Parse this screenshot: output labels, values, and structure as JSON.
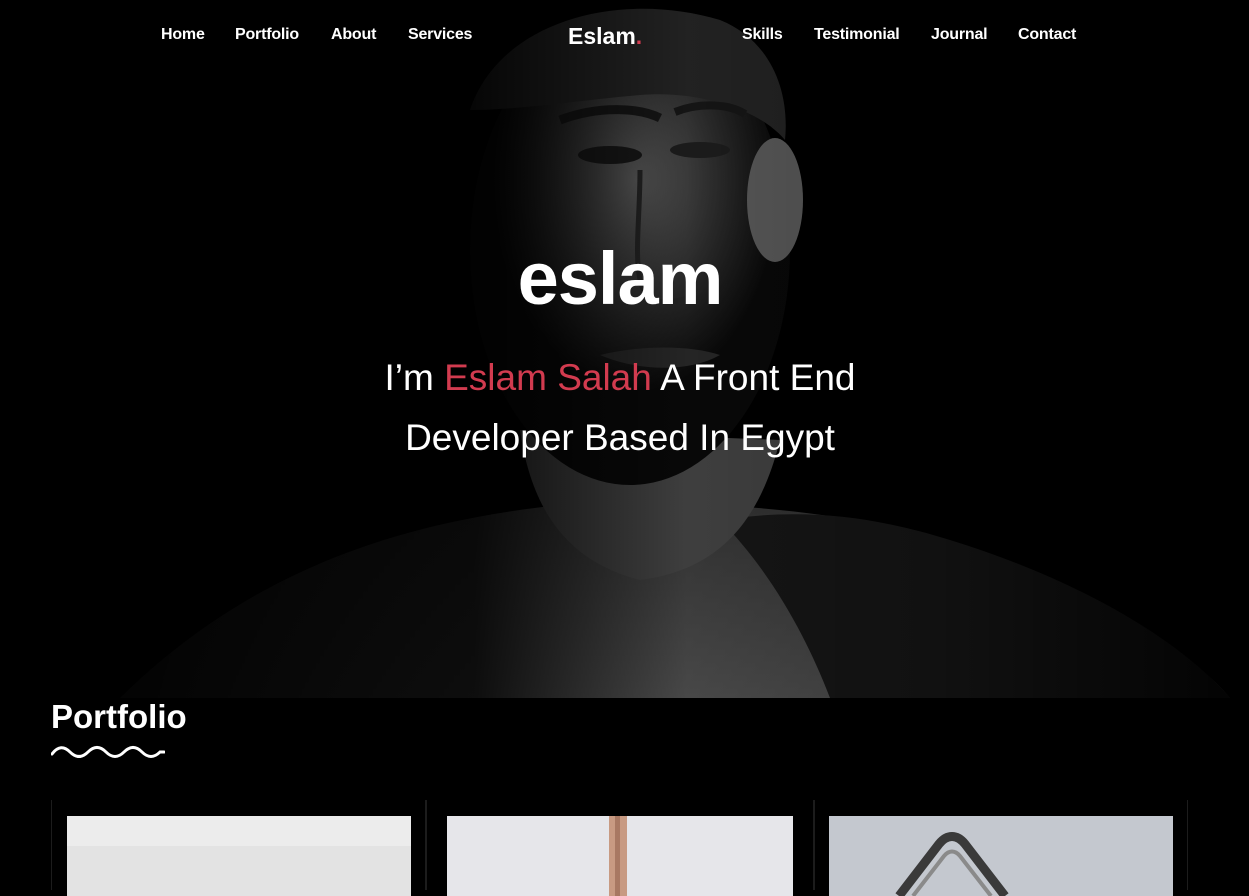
{
  "nav": {
    "left_links": [
      "Home",
      "Portfolio",
      "About",
      "Services"
    ],
    "brand": "Eslam",
    "brand_dot": ".",
    "right_links": [
      "Skills",
      "Testimonial",
      "Journal",
      "Contact"
    ]
  },
  "hero": {
    "title": "eslam",
    "subtitle_pre": "I’m ",
    "subtitle_name": "Eslam Salah",
    "subtitle_post_line1": " A Front End",
    "subtitle_line2": "Developer Based In Egypt"
  },
  "portfolio": {
    "title": "Portfolio",
    "items": [
      {
        "image": "portfolio-image-1"
      },
      {
        "image": "portfolio-image-2"
      },
      {
        "image": "portfolio-image-3"
      }
    ]
  },
  "colors": {
    "background": "#000000",
    "accent": "#d23b4f",
    "text": "#ffffff"
  }
}
